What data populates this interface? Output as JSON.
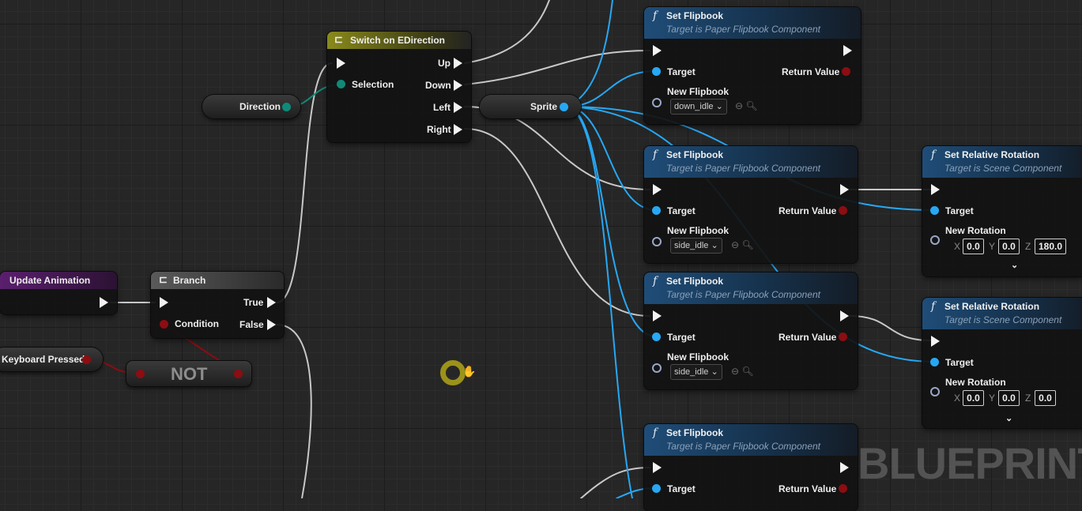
{
  "set_flipbook": {
    "title": "Set Flipbook",
    "subtitle": "Target is Paper Flipbook Component",
    "target": "Target",
    "return_value": "Return Value",
    "new_flipbook": "New Flipbook",
    "option_down": "down_idle",
    "option_side": "side_idle"
  },
  "set_rotation": {
    "title": "Set Relative Rotation",
    "subtitle": "Target is Scene Component",
    "target": "Target",
    "new_rotation": "New Rotation",
    "x_label": "X",
    "y_label": "Y",
    "z_label": "Z",
    "rot1": {
      "x": "0.0",
      "y": "0.0",
      "z": "180.0"
    },
    "rot2": {
      "x": "0.0",
      "y": "0.0",
      "z": "0.0"
    }
  },
  "switch": {
    "title": "Switch on EDirection",
    "selection": "Selection",
    "up": "Up",
    "down": "Down",
    "left": "Left",
    "right": "Right"
  },
  "branch": {
    "title": "Branch",
    "condition": "Condition",
    "true_label": "True",
    "false_label": "False"
  },
  "vars": {
    "direction": "Direction",
    "sprite": "Sprite",
    "keyboard_pressed": "Keyboard Pressed",
    "not_label": "NOT"
  },
  "event": {
    "title": "Update Animation"
  },
  "watermark": "BLUEPRINT",
  "colors": {
    "exec_wire": "#c8c8c8",
    "object_wire": "#26a8f4",
    "bool_wire": "#8c0d12",
    "function_header": "#1f4d78",
    "switch_header": "#8a8a1c",
    "event_header": "#5a1f6e",
    "cursor_ring": "#c2b91c"
  },
  "icons": {
    "function": "f-function-icon",
    "switch": "switch-icon",
    "branch": "branch-icon",
    "cursor": "grab-hand-cursor-icon"
  }
}
